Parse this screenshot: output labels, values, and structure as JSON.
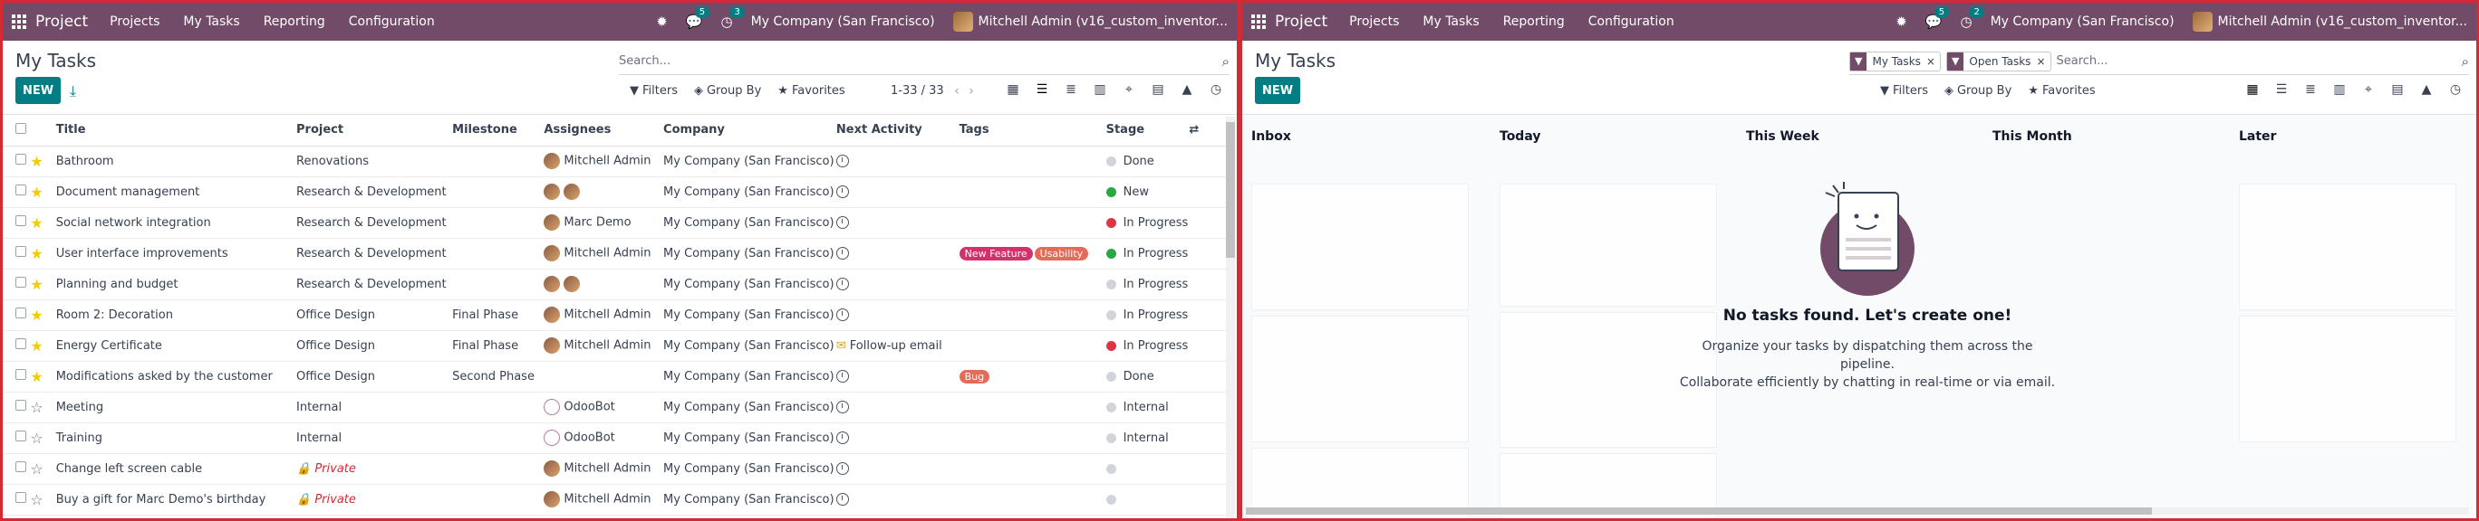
{
  "left": {
    "navbar": {
      "brand": "Project",
      "menu": [
        "Projects",
        "My Tasks",
        "Reporting",
        "Configuration"
      ],
      "messages_count": "5",
      "activities_count": "3",
      "company": "My Company (San Francisco)",
      "user": "Mitchell Admin (v16_custom_inventor..."
    },
    "title": "My Tasks",
    "new_label": "NEW",
    "search_placeholder": "Search...",
    "filters": [
      "Filters",
      "Group By",
      "Favorites"
    ],
    "pager": "1-33 / 33",
    "columns": [
      "Title",
      "Project",
      "Milestone",
      "Assignees",
      "Company",
      "Next Activity",
      "Tags",
      "Stage"
    ],
    "rows": [
      {
        "title": "Bathroom",
        "project": "Renovations",
        "milestone": "",
        "assignee": "Mitchell Admin",
        "avatars": 1,
        "company": "My Company (San Francisco)",
        "activity": "",
        "tags": [],
        "stage": "Done",
        "dot": "#d1d5db",
        "star": true,
        "private": false
      },
      {
        "title": "Document management",
        "project": "Research & Development",
        "milestone": "",
        "assignee": "",
        "avatars": 2,
        "company": "My Company (San Francisco)",
        "activity": "",
        "tags": [],
        "stage": "New",
        "dot": "#28a745",
        "star": true,
        "private": false
      },
      {
        "title": "Social network integration",
        "project": "Research & Development",
        "milestone": "",
        "assignee": "Marc Demo",
        "avatars": 1,
        "company": "My Company (San Francisco)",
        "activity": "",
        "tags": [],
        "stage": "In Progress",
        "dot": "#dc3545",
        "star": true,
        "private": false
      },
      {
        "title": "User interface improvements",
        "project": "Research & Development",
        "milestone": "",
        "assignee": "Mitchell Admin",
        "avatars": 1,
        "company": "My Company (San Francisco)",
        "activity": "",
        "tags": [
          {
            "label": "New Feature",
            "color": "#d2316a"
          },
          {
            "label": "Usability",
            "color": "#e36b58"
          }
        ],
        "stage": "In Progress",
        "dot": "#28a745",
        "star": true,
        "private": false
      },
      {
        "title": "Planning and budget",
        "project": "Research & Development",
        "milestone": "",
        "assignee": "",
        "avatars": 2,
        "company": "My Company (San Francisco)",
        "activity": "",
        "tags": [],
        "stage": "In Progress",
        "dot": "#d1d5db",
        "star": true,
        "private": false
      },
      {
        "title": "Room 2: Decoration",
        "project": "Office Design",
        "milestone": "Final Phase",
        "assignee": "Mitchell Admin",
        "avatars": 1,
        "company": "My Company (San Francisco)",
        "activity": "",
        "tags": [],
        "stage": "In Progress",
        "dot": "#d1d5db",
        "star": true,
        "private": false
      },
      {
        "title": "Energy Certificate",
        "project": "Office Design",
        "milestone": "Final Phase",
        "assignee": "Mitchell Admin",
        "avatars": 1,
        "company": "My Company (San Francisco)",
        "activity": "Follow-up email",
        "tags": [],
        "stage": "In Progress",
        "dot": "#dc3545",
        "star": true,
        "private": false
      },
      {
        "title": "Modifications asked by the customer",
        "project": "Office Design",
        "milestone": "Second Phase",
        "assignee": "",
        "avatars": 0,
        "company": "My Company (San Francisco)",
        "activity": "",
        "tags": [
          {
            "label": "Bug",
            "color": "#e36b58"
          }
        ],
        "stage": "Done",
        "dot": "#d1d5db",
        "star": true,
        "private": false
      },
      {
        "title": "Meeting",
        "project": "Internal",
        "milestone": "",
        "assignee": "OdooBot",
        "avatars": 1,
        "company": "My Company (San Francisco)",
        "activity": "",
        "tags": [],
        "stage": "Internal",
        "dot": "#d1d5db",
        "star": false,
        "private": false,
        "bot": true
      },
      {
        "title": "Training",
        "project": "Internal",
        "milestone": "",
        "assignee": "OdooBot",
        "avatars": 1,
        "company": "My Company (San Francisco)",
        "activity": "",
        "tags": [],
        "stage": "Internal",
        "dot": "#d1d5db",
        "star": false,
        "private": false,
        "bot": true
      },
      {
        "title": "Change left screen cable",
        "project": "Private",
        "milestone": "",
        "assignee": "Mitchell Admin",
        "avatars": 1,
        "company": "My Company (San Francisco)",
        "activity": "",
        "tags": [],
        "stage": "",
        "dot": "#d1d5db",
        "star": false,
        "private": true
      },
      {
        "title": "Buy a gift for Marc Demo's birthday",
        "project": "Private",
        "milestone": "",
        "assignee": "Mitchell Admin",
        "avatars": 1,
        "company": "My Company (San Francisco)",
        "activity": "",
        "tags": [],
        "stage": "",
        "dot": "#d1d5db",
        "star": false,
        "private": true
      }
    ]
  },
  "right": {
    "navbar": {
      "brand": "Project",
      "menu": [
        "Projects",
        "My Tasks",
        "Reporting",
        "Configuration"
      ],
      "messages_count": "5",
      "activities_count": "2",
      "company": "My Company (San Francisco)",
      "user": "Mitchell Admin (v16_custom_inventor..."
    },
    "title": "My Tasks",
    "new_label": "NEW",
    "facets": [
      "My Tasks",
      "Open Tasks"
    ],
    "search_placeholder": "Search...",
    "filters": [
      "Filters",
      "Group By",
      "Favorites"
    ],
    "columns": [
      "Inbox",
      "Today",
      "This Week",
      "This Month",
      "Later"
    ],
    "empty_title": "No tasks found. Let's create one!",
    "empty_line1": "Organize your tasks by dispatching them across the pipeline.",
    "empty_line2": "Collaborate efficiently by chatting in real-time or via email."
  },
  "colors": {
    "brand": "#714b67",
    "primary": "#017e84",
    "frame": "#d22b34"
  }
}
